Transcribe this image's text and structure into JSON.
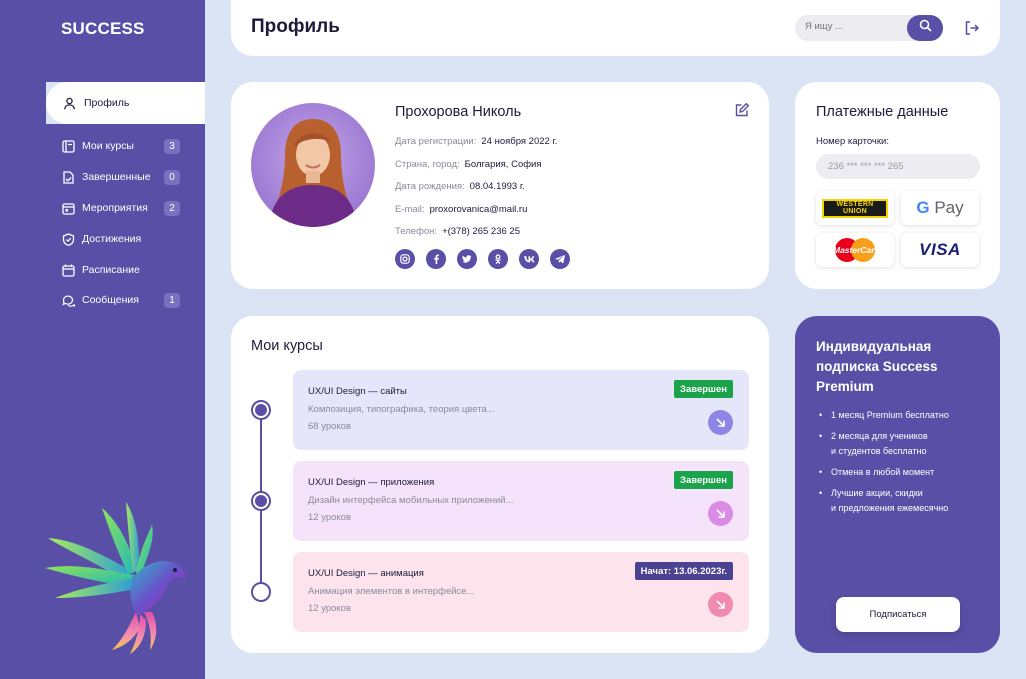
{
  "app": {
    "logo": "SUCCESS"
  },
  "header": {
    "title": "Профиль",
    "search_placeholder": "Я ищу ..."
  },
  "sidebar": {
    "active": {
      "label": "Профиль",
      "icon": "user-icon"
    },
    "items": [
      {
        "label": "Мои курсы",
        "badge": "3",
        "icon": "courses-icon"
      },
      {
        "label": "Завершенные",
        "badge": "0",
        "icon": "completed-icon"
      },
      {
        "label": "Мероприятия",
        "badge": "2",
        "icon": "calendar-icon"
      },
      {
        "label": "Достижения",
        "badge": "",
        "icon": "shield-icon"
      },
      {
        "label": "Расписание",
        "badge": "",
        "icon": "schedule-icon"
      },
      {
        "label": "Сообщения",
        "badge": "1",
        "icon": "messages-icon"
      }
    ]
  },
  "profile": {
    "name": "Прохорова Николь",
    "rows": [
      {
        "label": "Дата регистрации:",
        "value": "24 ноября 2022 г."
      },
      {
        "label": "Страна, город:",
        "value": "Болгария, София"
      },
      {
        "label": "Дата рождения:",
        "value": "08.04.1993 г."
      },
      {
        "label": "E-mail:",
        "value": "proxorovanica@mail.ru"
      },
      {
        "label": "Телефон:",
        "value": "+(378) 265 236 25"
      }
    ],
    "socials": [
      "instagram",
      "facebook",
      "twitter",
      "odnoklassniki",
      "vk",
      "telegram"
    ]
  },
  "payment": {
    "title": "Платежные данные",
    "card_label": "Номер карточки:",
    "card_number": "236 *** *** *** 265",
    "methods": {
      "western_union_line1": "WESTERN",
      "western_union_line2": "UNION",
      "gpay_g": "G",
      "gpay_text": "Pay",
      "mastercard": "MasterCard",
      "visa": "VISA"
    }
  },
  "courses": {
    "title": "Мои курсы",
    "items": [
      {
        "title": "UX/UI Design — сайты",
        "desc": "Композиция, типографика, теория цвета...",
        "lessons": "68 уроков",
        "status": "Завершен",
        "status_color": "#1aa34a",
        "bg": "#e6e6fb",
        "arrow_color": "#8d86e6",
        "done": true
      },
      {
        "title": "UX/UI Design — приложения",
        "desc": "Дизайн интерфейса мобильных приложений...",
        "lessons": "12 уроков",
        "status": "Завершен",
        "status_color": "#1aa34a",
        "bg": "#f4e3fb",
        "arrow_color": "#d98be6",
        "done": true
      },
      {
        "title": "UX/UI Design — анимация",
        "desc": "Анимация элементов в интерфейсе...",
        "lessons": "12 уроков",
        "status": "Начат: 13.06.2023г.",
        "status_color": "#4b4391",
        "bg": "#fde4ec",
        "arrow_color": "#f08ab0",
        "done": false
      }
    ]
  },
  "premium": {
    "title": "Индивидуальная подписка Success Premium",
    "features": [
      "1 месяц Premium бесплатно",
      "2 месяца для учеников\nи студентов бесплатно",
      "Отмена в любой момент",
      "Лучшие акции, скидки\nи предложения ежемесячно"
    ],
    "button": "Подписаться"
  },
  "colors": {
    "accent": "#5a4fa6",
    "background": "#dbe4f4",
    "success": "#1aa34a"
  }
}
